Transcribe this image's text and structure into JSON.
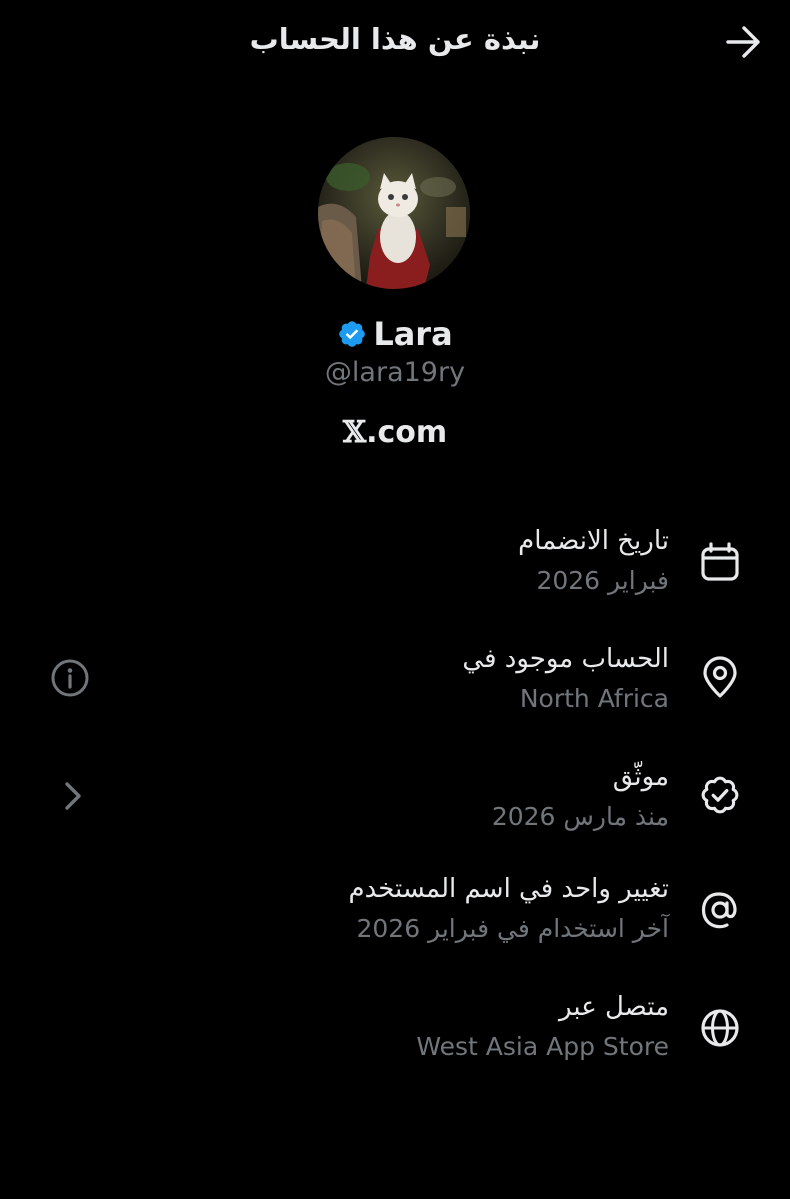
{
  "header": {
    "title": "نبذة عن هذا الحساب",
    "back_icon": "arrow-right-icon"
  },
  "profile": {
    "name": "Lara",
    "verified_icon": "verified-badge-icon",
    "handle": "@lara19ry",
    "website": ".com",
    "website_logo": "𝕏"
  },
  "info": {
    "join_date": {
      "icon": "calendar-icon",
      "title": "تاريخ الانضمام",
      "value": "فبراير 2026"
    },
    "location": {
      "icon": "location-pin-icon",
      "title": "الحساب موجود في",
      "value": "North Africa",
      "side_icon": "info-icon"
    },
    "verified": {
      "icon": "verified-check-icon",
      "title": "موثّق",
      "value": "منذ مارس 2026",
      "side_icon": "chevron-left-icon"
    },
    "username_change": {
      "icon": "at-sign-icon",
      "title": "تغيير واحد في اسم المستخدم",
      "value": "آخر استخدام في فبراير 2026"
    },
    "connected_via": {
      "icon": "globe-icon",
      "title": "متصل عبر",
      "value": "West Asia App Store"
    }
  },
  "colors": {
    "background": "#000000",
    "text_primary": "#e7e9ea",
    "text_secondary": "#71767b",
    "verified_blue": "#1d9bf0"
  }
}
